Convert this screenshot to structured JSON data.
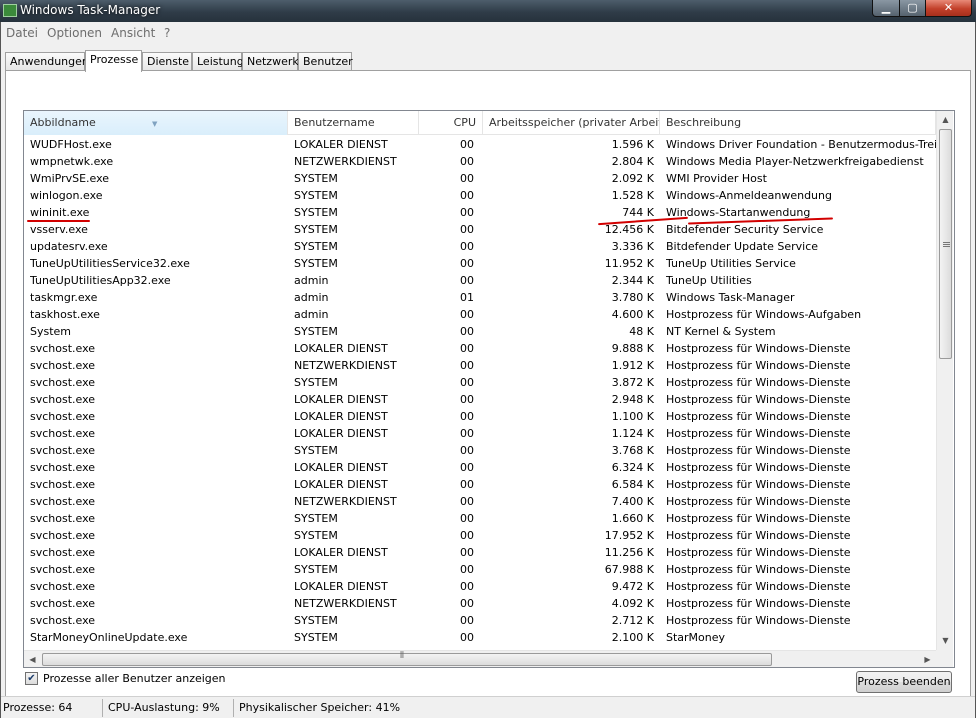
{
  "window": {
    "title": "Windows Task-Manager",
    "min_glyph": "▁",
    "max_glyph": "▢",
    "close_glyph": "✕"
  },
  "menu": [
    "Datei",
    "Optionen",
    "Ansicht",
    "?"
  ],
  "tabs": [
    "Anwendungen",
    "Prozesse",
    "Dienste",
    "Leistung",
    "Netzwerk",
    "Benutzer"
  ],
  "active_tab": "Prozesse",
  "columns": [
    "Abbildname",
    "Benutzername",
    "CPU",
    "Arbeitsspeicher (privater Arbeit...",
    "Beschreibung"
  ],
  "sort_indicator": "▼",
  "processes": [
    [
      "WUDFHost.exe",
      "LOKALER DIENST",
      "00",
      "1.596 K",
      "Windows Driver Foundation - Benutzermodus-Treiberframework-Hostprozess"
    ],
    [
      "wmpnetwk.exe",
      "NETZWERKDIENST",
      "00",
      "2.804 K",
      "Windows Media Player-Netzwerkfreigabedienst"
    ],
    [
      "WmiPrvSE.exe",
      "SYSTEM",
      "00",
      "2.092 K",
      "WMI Provider Host"
    ],
    [
      "winlogon.exe",
      "SYSTEM",
      "00",
      "1.528 K",
      "Windows-Anmeldeanwendung"
    ],
    [
      "wininit.exe",
      "SYSTEM",
      "00",
      "744 K",
      "Windows-Startanwendung"
    ],
    [
      "vsserv.exe",
      "SYSTEM",
      "00",
      "12.456 K",
      "Bitdefender Security Service"
    ],
    [
      "updatesrv.exe",
      "SYSTEM",
      "00",
      "3.336 K",
      "Bitdefender Update Service"
    ],
    [
      "TuneUpUtilitiesService32.exe",
      "SYSTEM",
      "00",
      "11.952 K",
      "TuneUp Utilities Service"
    ],
    [
      "TuneUpUtilitiesApp32.exe",
      "admin",
      "00",
      "2.344 K",
      "TuneUp Utilities"
    ],
    [
      "taskmgr.exe",
      "admin",
      "01",
      "3.780 K",
      "Windows Task-Manager"
    ],
    [
      "taskhost.exe",
      "admin",
      "00",
      "4.600 K",
      "Hostprozess für Windows-Aufgaben"
    ],
    [
      "System",
      "SYSTEM",
      "00",
      "48 K",
      "NT Kernel & System"
    ],
    [
      "svchost.exe",
      "LOKALER DIENST",
      "00",
      "9.888 K",
      "Hostprozess für Windows-Dienste"
    ],
    [
      "svchost.exe",
      "NETZWERKDIENST",
      "00",
      "1.912 K",
      "Hostprozess für Windows-Dienste"
    ],
    [
      "svchost.exe",
      "SYSTEM",
      "00",
      "3.872 K",
      "Hostprozess für Windows-Dienste"
    ],
    [
      "svchost.exe",
      "LOKALER DIENST",
      "00",
      "2.948 K",
      "Hostprozess für Windows-Dienste"
    ],
    [
      "svchost.exe",
      "LOKALER DIENST",
      "00",
      "1.100 K",
      "Hostprozess für Windows-Dienste"
    ],
    [
      "svchost.exe",
      "LOKALER DIENST",
      "00",
      "1.124 K",
      "Hostprozess für Windows-Dienste"
    ],
    [
      "svchost.exe",
      "SYSTEM",
      "00",
      "3.768 K",
      "Hostprozess für Windows-Dienste"
    ],
    [
      "svchost.exe",
      "LOKALER DIENST",
      "00",
      "6.324 K",
      "Hostprozess für Windows-Dienste"
    ],
    [
      "svchost.exe",
      "LOKALER DIENST",
      "00",
      "6.584 K",
      "Hostprozess für Windows-Dienste"
    ],
    [
      "svchost.exe",
      "NETZWERKDIENST",
      "00",
      "7.400 K",
      "Hostprozess für Windows-Dienste"
    ],
    [
      "svchost.exe",
      "SYSTEM",
      "00",
      "1.660 K",
      "Hostprozess für Windows-Dienste"
    ],
    [
      "svchost.exe",
      "SYSTEM",
      "00",
      "17.952 K",
      "Hostprozess für Windows-Dienste"
    ],
    [
      "svchost.exe",
      "LOKALER DIENST",
      "00",
      "11.256 K",
      "Hostprozess für Windows-Dienste"
    ],
    [
      "svchost.exe",
      "SYSTEM",
      "00",
      "67.988 K",
      "Hostprozess für Windows-Dienste"
    ],
    [
      "svchost.exe",
      "LOKALER DIENST",
      "00",
      "9.472 K",
      "Hostprozess für Windows-Dienste"
    ],
    [
      "svchost.exe",
      "NETZWERKDIENST",
      "00",
      "4.092 K",
      "Hostprozess für Windows-Dienste"
    ],
    [
      "svchost.exe",
      "SYSTEM",
      "00",
      "2.712 K",
      "Hostprozess für Windows-Dienste"
    ],
    [
      "StarMoneyOnlineUpdate.exe",
      "SYSTEM",
      "00",
      "2.100 K",
      "StarMoney"
    ]
  ],
  "highlighted_row_index": 5,
  "show_all_users": {
    "label": "Prozesse aller Benutzer anzeigen",
    "checked": true,
    "check_glyph": "✔"
  },
  "end_process_button": "Prozess beenden",
  "status": {
    "processes": "Prozesse: 64",
    "cpu": "CPU-Auslastung: 9%",
    "memory": "Physikalischer Speicher: 41%"
  },
  "scroll_glyphs": {
    "up": "▲",
    "down": "▼",
    "left": "◀",
    "right": "▶",
    "grip": "⦀"
  },
  "colors": {
    "annotation_red": "#d20000",
    "titlebar": "#2f3c48",
    "close_button": "#c2402a"
  }
}
